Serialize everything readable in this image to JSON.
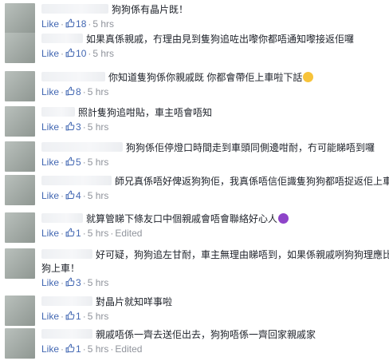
{
  "like_label": "Like",
  "time_label": "5 hrs",
  "edited_label": "Edited",
  "colors": {
    "link": "#4267b2",
    "meta": "#90949c",
    "text": "#1d2129"
  },
  "comments": [
    {
      "lines": [
        "狗狗係有晶片既！"
      ],
      "likes": "18"
    },
    {
      "lines": [
        "如果真係親戚，冇理由見到隻狗追咗出嚟你都唔通知嚟接返佢囉"
      ],
      "likes": "10"
    },
    {
      "lines": [
        "你知道隻狗係你親戚既 你都會帶佢上車啦下話"
      ],
      "emoji": "sweat-smile-icon",
      "likes": "8"
    },
    {
      "lines": [
        "照計隻狗追咁貼，車主唔會唔知"
      ],
      "likes": "3"
    },
    {
      "lines": [
        "狗狗係佢停燈口時間走到車頭同側邊咁耐，冇可能睇唔到囉"
      ],
      "likes": "5"
    },
    {
      "lines": [
        "師兄真係唔好俾返狗狗佢，我真係唔信佢識隻狗狗都唔捉返佢上車"
      ],
      "likes": "4"
    },
    {
      "lines": [
        "就算管睇下條友口中個親戚會唔會聯絡好心人"
      ],
      "emoji": "devil-icon",
      "likes": "1",
      "edited": true
    },
    {
      "lines": [
        "好可疑，狗狗追左甘耐，車主無理由睇唔到，如果係親戚咧狗狗理應比狗",
        "狗上車！"
      ],
      "likes": "3"
    },
    {
      "lines": [
        "對晶片就知咩事啦"
      ],
      "likes": "1"
    },
    {
      "lines": [
        "親戚唔係一齊去送佢出去，狗狗唔係一齊回家親戚家"
      ],
      "likes": "1",
      "edited": true
    }
  ]
}
